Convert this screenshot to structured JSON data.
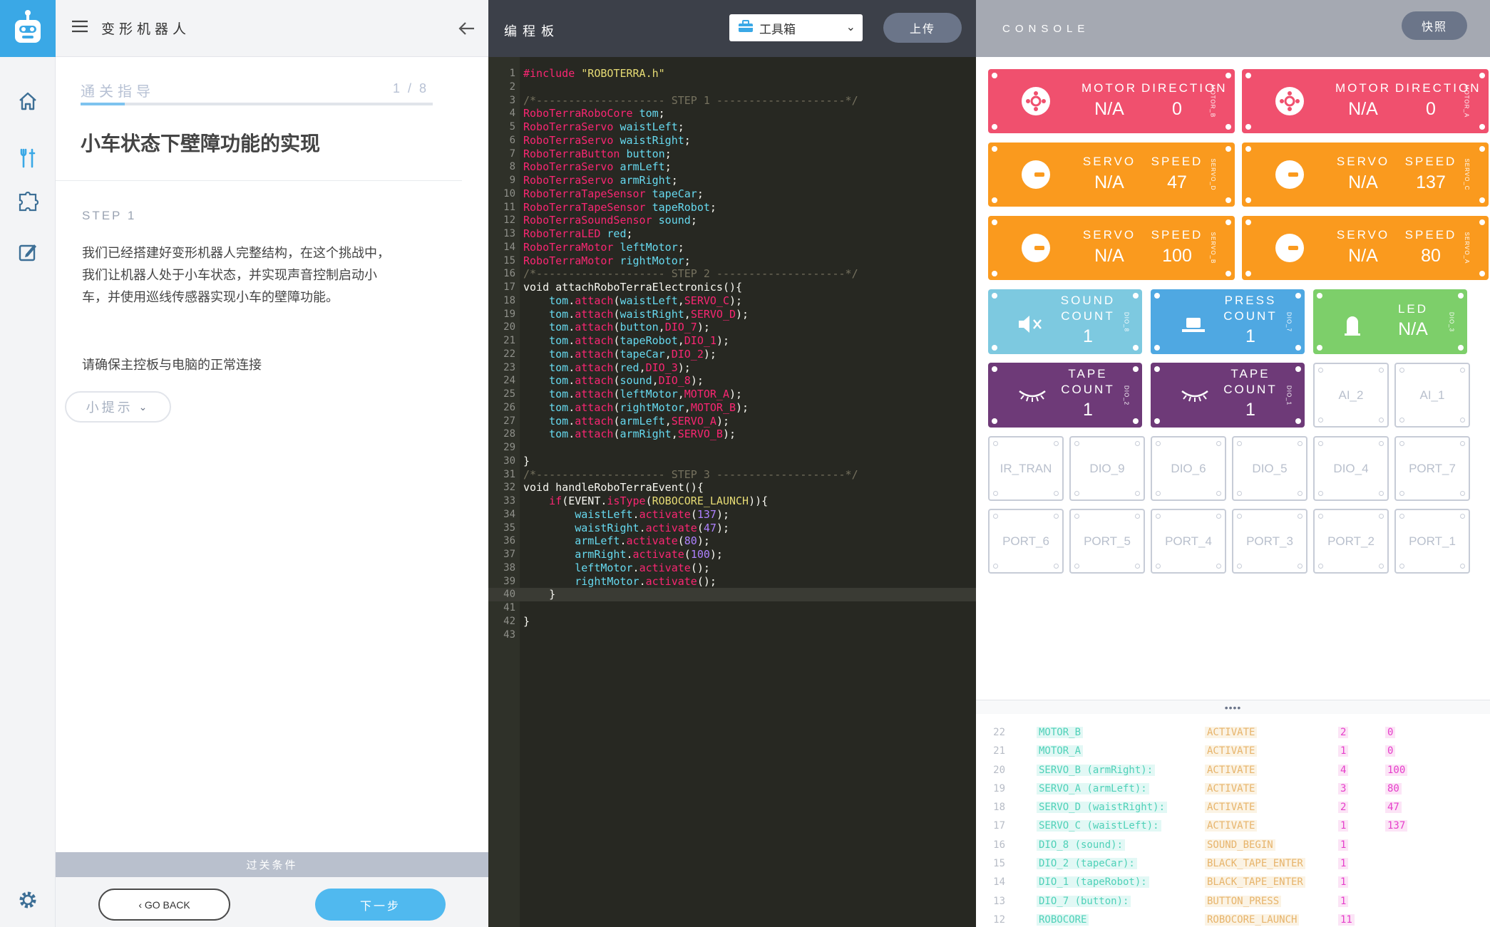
{
  "app": {
    "title": "变形机器人"
  },
  "guide": {
    "progress_label": "通关指导",
    "progress_count": "1 / 8",
    "progress_fraction": 0.125,
    "heading": "小车状态下壁障功能的实现",
    "step": "STEP 1",
    "paragraph": "我们已经搭建好变形机器人完整结构，在这个挑战中，我们让机器人处于小车状态，并实现声音控制启动小车，并使用巡线传感器实现小车的壁障功能。",
    "paragraph2": "请确保主控板与电脑的正常连接",
    "hint_label": "小提示",
    "condition_label": "过关条件",
    "go_back": "‹ GO BACK",
    "next": "下一步"
  },
  "editor": {
    "title": "编程板",
    "toolbox_label": "工具箱",
    "upload_label": "上传",
    "active_line": 40,
    "lines": [
      "#include \"ROBOTERRA.h\"",
      "",
      "/*-------------------- STEP 1 --------------------*/",
      "RoboTerraRoboCore tom;",
      "RoboTerraServo waistLeft;",
      "RoboTerraServo waistRight;",
      "RoboTerraButton button;",
      "RoboTerraServo armLeft;",
      "RoboTerraServo armRight;",
      "RoboTerraTapeSensor tapeCar;",
      "RoboTerraTapeSensor tapeRobot;",
      "RoboTerraSoundSensor sound;",
      "RoboTerraLED red;",
      "RoboTerraMotor leftMotor;",
      "RoboTerraMotor rightMotor;",
      "/*-------------------- STEP 2 --------------------*/",
      "void attachRoboTerraElectronics(){",
      "    tom.attach(waistLeft,SERVO_C);",
      "    tom.attach(waistRight,SERVO_D);",
      "    tom.attach(button,DIO_7);",
      "    tom.attach(tapeRobot,DIO_1);",
      "    tom.attach(tapeCar,DIO_2);",
      "    tom.attach(red,DIO_3);",
      "    tom.attach(sound,DIO_8);",
      "    tom.attach(leftMotor,MOTOR_A);",
      "    tom.attach(rightMotor,MOTOR_B);",
      "    tom.attach(armLeft,SERVO_A);",
      "    tom.attach(armRight,SERVO_B);",
      "",
      "}",
      "/*-------------------- STEP 3 --------------------*/",
      "void handleRoboTerraEvent(){",
      "    if(EVENT.isType(ROBOCORE_LAUNCH)){",
      "        waistLeft.activate(137);",
      "        waistRight.activate(47);",
      "        armLeft.activate(80);",
      "        armRight.activate(100);",
      "        leftMotor.activate();",
      "        rightMotor.activate();",
      "    }",
      "",
      "}",
      ""
    ]
  },
  "console": {
    "title": "CONSOLE",
    "snapshot_label": "快照",
    "cards": [
      {
        "kind": "motor",
        "color": "#f0506e",
        "lbl1": "MOTOR",
        "lbl2": "DIRECTION",
        "val1": "N/A",
        "val2": "0",
        "side": "MOTOR_B",
        "icon": "motor-icon"
      },
      {
        "kind": "motor",
        "color": "#f0506e",
        "lbl1": "MOTOR",
        "lbl2": "DIRECTION",
        "val1": "N/A",
        "val2": "0",
        "side": "MOTOR_A",
        "icon": "motor-icon"
      },
      {
        "kind": "servo",
        "color": "#fa9a1e",
        "lbl1": "SERVO",
        "lbl2": "SPEED",
        "val1": "N/A",
        "val2": "47",
        "side": "SERVO_D",
        "icon": "servo-icon"
      },
      {
        "kind": "servo",
        "color": "#fa9a1e",
        "lbl1": "SERVO",
        "lbl2": "SPEED",
        "val1": "N/A",
        "val2": "137",
        "side": "SERVO_C",
        "icon": "servo-icon"
      },
      {
        "kind": "servo",
        "color": "#fa9a1e",
        "lbl1": "SERVO",
        "lbl2": "SPEED",
        "val1": "N/A",
        "val2": "100",
        "side": "SERVO_B",
        "icon": "servo-icon"
      },
      {
        "kind": "servo",
        "color": "#fa9a1e",
        "lbl1": "SERVO",
        "lbl2": "SPEED",
        "val1": "N/A",
        "val2": "80",
        "side": "SERVO_A",
        "icon": "servo-icon"
      },
      {
        "kind": "sound",
        "color": "#7dc9e0",
        "lbl": "SOUND COUNT",
        "val": "1",
        "side": "DIO_8",
        "icon": "mute-icon"
      },
      {
        "kind": "press",
        "color": "#4fa8e2",
        "lbl": "PRESS COUNT",
        "val": "1",
        "side": "DIO_7",
        "icon": "button-icon"
      },
      {
        "kind": "led",
        "color": "#7dcf6a",
        "lbl": "LED",
        "val": "N/A",
        "side": "DIO_3",
        "icon": "led-icon"
      },
      {
        "kind": "tape",
        "color": "#6e3a78",
        "lbl": "TAPE COUNT",
        "val": "1",
        "side": "DIO_2",
        "icon": "eye-closed-icon"
      },
      {
        "kind": "tape",
        "color": "#6e3a78",
        "lbl": "TAPE COUNT",
        "val": "1",
        "side": "DIO_1",
        "icon": "eye-closed-icon"
      }
    ],
    "ai_ports": [
      "AI_2",
      "AI_1"
    ],
    "port_row1": [
      "IR_TRAN",
      "DIO_9",
      "DIO_6",
      "DIO_5",
      "DIO_4",
      "PORT_7"
    ],
    "port_row2": [
      "PORT_6",
      "PORT_5",
      "PORT_4",
      "PORT_3",
      "PORT_2",
      "PORT_1"
    ],
    "drag_handle": "••••",
    "log": [
      {
        "n": "22",
        "dev": "MOTOR_B",
        "evt": "ACTIVATE",
        "p1": "2",
        "p2": "0"
      },
      {
        "n": "21",
        "dev": "MOTOR_A",
        "evt": "ACTIVATE",
        "p1": "1",
        "p2": "0"
      },
      {
        "n": "20",
        "dev": "SERVO_B (armRight):",
        "evt": "ACTIVATE",
        "p1": "4",
        "p2": "100"
      },
      {
        "n": "19",
        "dev": "SERVO_A (armLeft):",
        "evt": "ACTIVATE",
        "p1": "3",
        "p2": "80"
      },
      {
        "n": "18",
        "dev": "SERVO_D (waistRight):",
        "evt": "ACTIVATE",
        "p1": "2",
        "p2": "47"
      },
      {
        "n": "17",
        "dev": "SERVO_C (waistLeft):",
        "evt": "ACTIVATE",
        "p1": "1",
        "p2": "137"
      },
      {
        "n": "16",
        "dev": "DIO_8 (sound):",
        "evt": "SOUND_BEGIN",
        "p1": "1",
        "p2": ""
      },
      {
        "n": "15",
        "dev": "DIO_2 (tapeCar):",
        "evt": "BLACK_TAPE_ENTER",
        "p1": "1",
        "p2": ""
      },
      {
        "n": "14",
        "dev": "DIO_1 (tapeRobot):",
        "evt": "BLACK_TAPE_ENTER",
        "p1": "1",
        "p2": ""
      },
      {
        "n": "13",
        "dev": "DIO_7 (button):",
        "evt": "BUTTON_PRESS",
        "p1": "1",
        "p2": ""
      },
      {
        "n": "12",
        "dev": "ROBOCORE",
        "evt": "ROBOCORE_LAUNCH",
        "p1": "11",
        "p2": ""
      }
    ]
  },
  "colors": {
    "accent": "#3aa8e6",
    "editor_bg": "#272822",
    "motor": "#f0506e",
    "servo": "#fa9a1e",
    "purple": "#6e3a78"
  }
}
